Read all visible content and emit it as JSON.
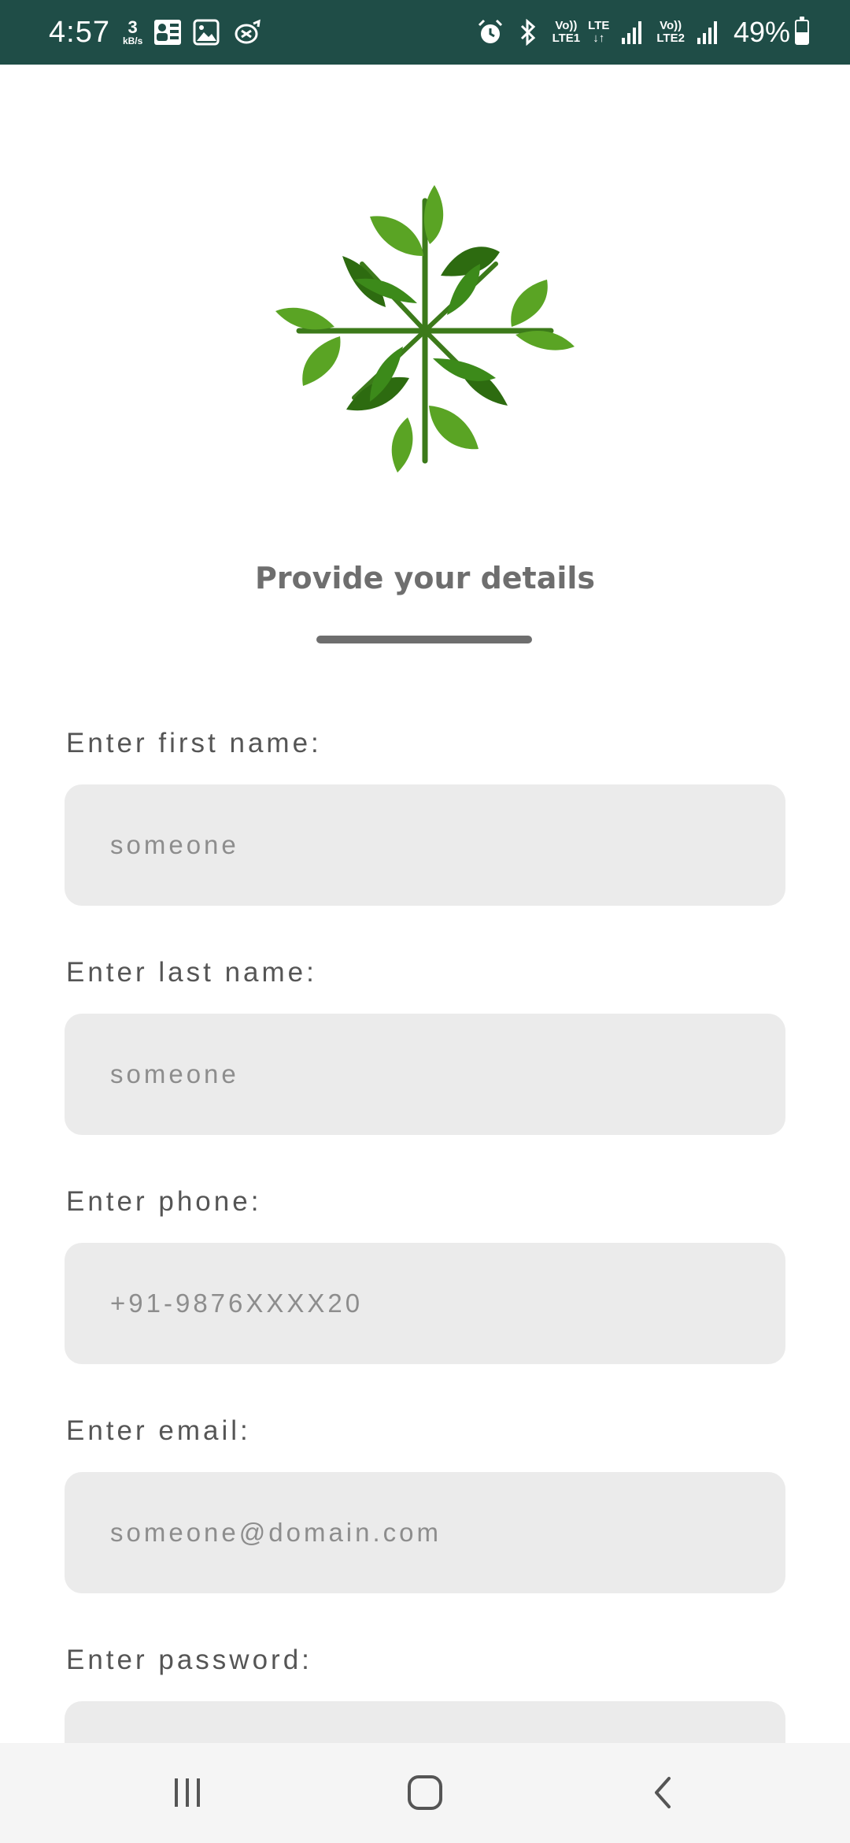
{
  "status_bar": {
    "time": "4:57",
    "speed_value": "3",
    "speed_unit": "kB/s",
    "sim1_line1": "Vo))",
    "sim1_line2": "LTE1",
    "lte_label": "LTE",
    "sim2_line1": "Vo))",
    "sim2_line2": "LTE2",
    "battery_percent": "49%",
    "battery_level": 0.49,
    "icons": [
      "news-icon",
      "gallery-icon",
      "hourglass-icon",
      "alarm-icon",
      "bluetooth-icon",
      "signal-icon"
    ]
  },
  "logo": {
    "name": "leaf-cross-logo",
    "colors": [
      "#3c8a1a",
      "#5aa424",
      "#2d6b10"
    ]
  },
  "form": {
    "heading": "Provide your details",
    "fields": [
      {
        "label": "Enter first name:",
        "placeholder": "someone",
        "value": ""
      },
      {
        "label": "Enter last name:",
        "placeholder": "someone",
        "value": ""
      },
      {
        "label": "Enter phone:",
        "placeholder": "+91-9876XXXX20",
        "value": ""
      },
      {
        "label": "Enter email:",
        "placeholder": "someone@domain.com",
        "value": ""
      },
      {
        "label": "Enter password:",
        "placeholder": "",
        "value": ""
      }
    ]
  },
  "nav_bar": {
    "buttons": [
      "recent-apps",
      "home",
      "back"
    ]
  },
  "colors": {
    "status_bar_bg": "#1f4d47",
    "heading": "#6e6e6e",
    "input_bg": "#ebebeb"
  }
}
